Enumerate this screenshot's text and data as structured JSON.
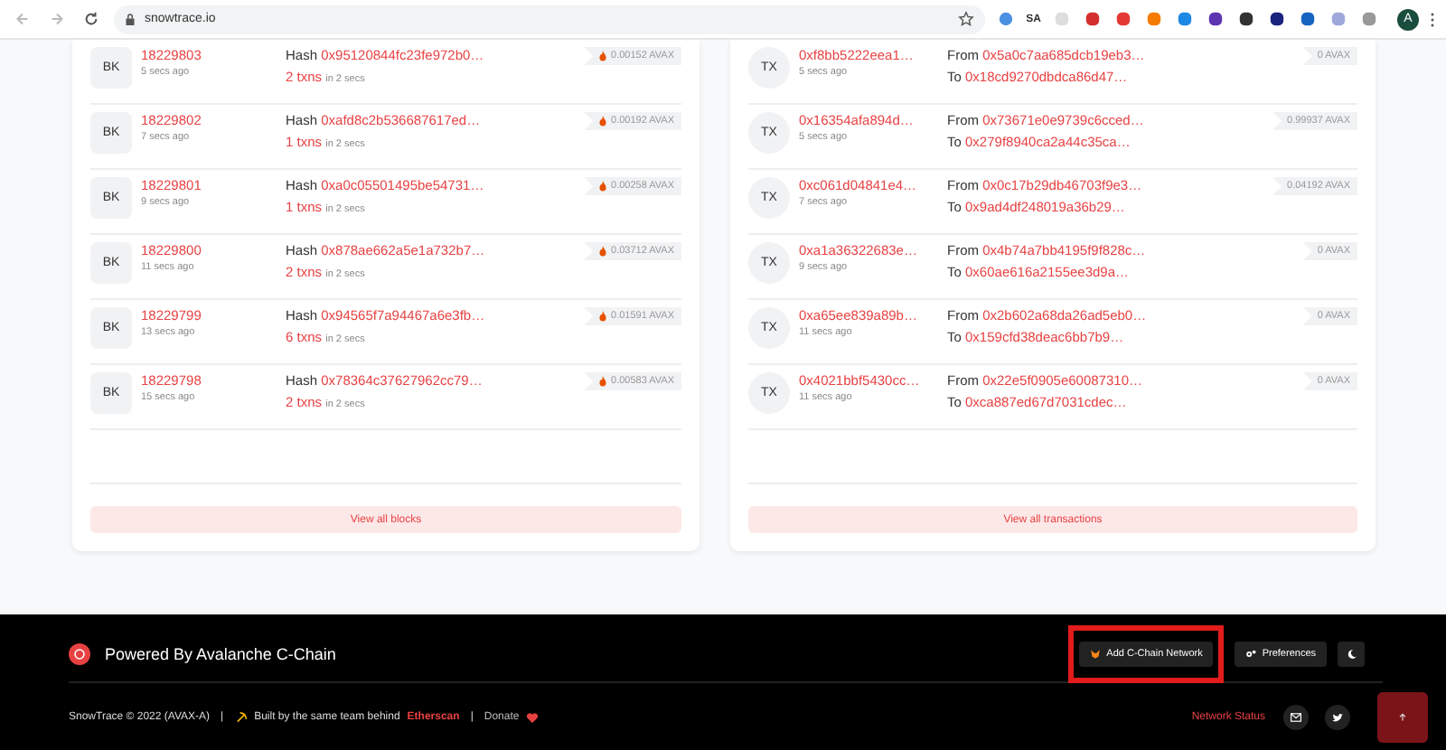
{
  "browser": {
    "url": "snowtrace.io",
    "extension_label": "SA",
    "profile_initial": "A"
  },
  "blocks": {
    "rows": [
      {
        "badge": "BK",
        "number": "18229803",
        "age": "5 secs ago",
        "hash_label": "Hash",
        "hash": "0x95120844fc23fe972b0…",
        "txns": "2 txns",
        "duration": "in 2 secs",
        "reward": "0.00152 AVAX"
      },
      {
        "badge": "BK",
        "number": "18229802",
        "age": "7 secs ago",
        "hash_label": "Hash",
        "hash": "0xafd8c2b536687617ed…",
        "txns": "1 txns",
        "duration": "in 2 secs",
        "reward": "0.00192 AVAX"
      },
      {
        "badge": "BK",
        "number": "18229801",
        "age": "9 secs ago",
        "hash_label": "Hash",
        "hash": "0xa0c05501495be54731…",
        "txns": "1 txns",
        "duration": "in 2 secs",
        "reward": "0.00258 AVAX"
      },
      {
        "badge": "BK",
        "number": "18229800",
        "age": "11 secs ago",
        "hash_label": "Hash",
        "hash": "0x878ae662a5e1a732b7…",
        "txns": "2 txns",
        "duration": "in 2 secs",
        "reward": "0.03712 AVAX"
      },
      {
        "badge": "BK",
        "number": "18229799",
        "age": "13 secs ago",
        "hash_label": "Hash",
        "hash": "0x94565f7a94467a6e3fb…",
        "txns": "6 txns",
        "duration": "in 2 secs",
        "reward": "0.01591 AVAX"
      },
      {
        "badge": "BK",
        "number": "18229798",
        "age": "15 secs ago",
        "hash_label": "Hash",
        "hash": "0x78364c37627962cc79…",
        "txns": "2 txns",
        "duration": "in 2 secs",
        "reward": "0.00583 AVAX"
      }
    ],
    "button": "View all blocks"
  },
  "transactions": {
    "rows": [
      {
        "badge": "TX",
        "hash": "0xf8bb5222eea1…",
        "age": "5 secs ago",
        "from_label": "From",
        "from": "0x5a0c7aa685dcb19eb3…",
        "to_label": "To",
        "to": "0x18cd9270dbdca86d47…",
        "value": "0 AVAX"
      },
      {
        "badge": "TX",
        "hash": "0x16354afa894d…",
        "age": "5 secs ago",
        "from_label": "From",
        "from": "0x73671e0e9739c6cced…",
        "to_label": "To",
        "to": "0x279f8940ca2a44c35ca…",
        "value": "0.99937 AVAX"
      },
      {
        "badge": "TX",
        "hash": "0xc061d04841e4…",
        "age": "7 secs ago",
        "from_label": "From",
        "from": "0x0c17b29db46703f9e3…",
        "to_label": "To",
        "to": "0x9ad4df248019a36b29…",
        "value": "0.04192 AVAX"
      },
      {
        "badge": "TX",
        "hash": "0xa1a36322683e…",
        "age": "9 secs ago",
        "from_label": "From",
        "from": "0x4b74a7bb4195f9f828c…",
        "to_label": "To",
        "to": "0x60ae616a2155ee3d9a…",
        "value": "0 AVAX"
      },
      {
        "badge": "TX",
        "hash": "0xa65ee839a89b…",
        "age": "11 secs ago",
        "from_label": "From",
        "from": "0x2b602a68da26ad5eb0…",
        "to_label": "To",
        "to": "0x159cfd38deac6bb7b9…",
        "value": "0 AVAX"
      },
      {
        "badge": "TX",
        "hash": "0x4021bbf5430cc…",
        "age": "11 secs ago",
        "from_label": "From",
        "from": "0x22e5f0905e60087310…",
        "to_label": "To",
        "to": "0xca887ed67d7031cdec…",
        "value": "0 AVAX"
      }
    ],
    "button": "View all transactions"
  },
  "footer": {
    "powered": "Powered By Avalanche C-Chain",
    "add_network": "Add C-Chain Network",
    "preferences": "Preferences",
    "copyright": "SnowTrace © 2022 (AVAX-A)",
    "separator_1": "|",
    "built_by": "Built by the same team behind",
    "etherscan": "Etherscan",
    "separator_2": "|",
    "donate": "Donate",
    "network_status": "Network Status"
  }
}
